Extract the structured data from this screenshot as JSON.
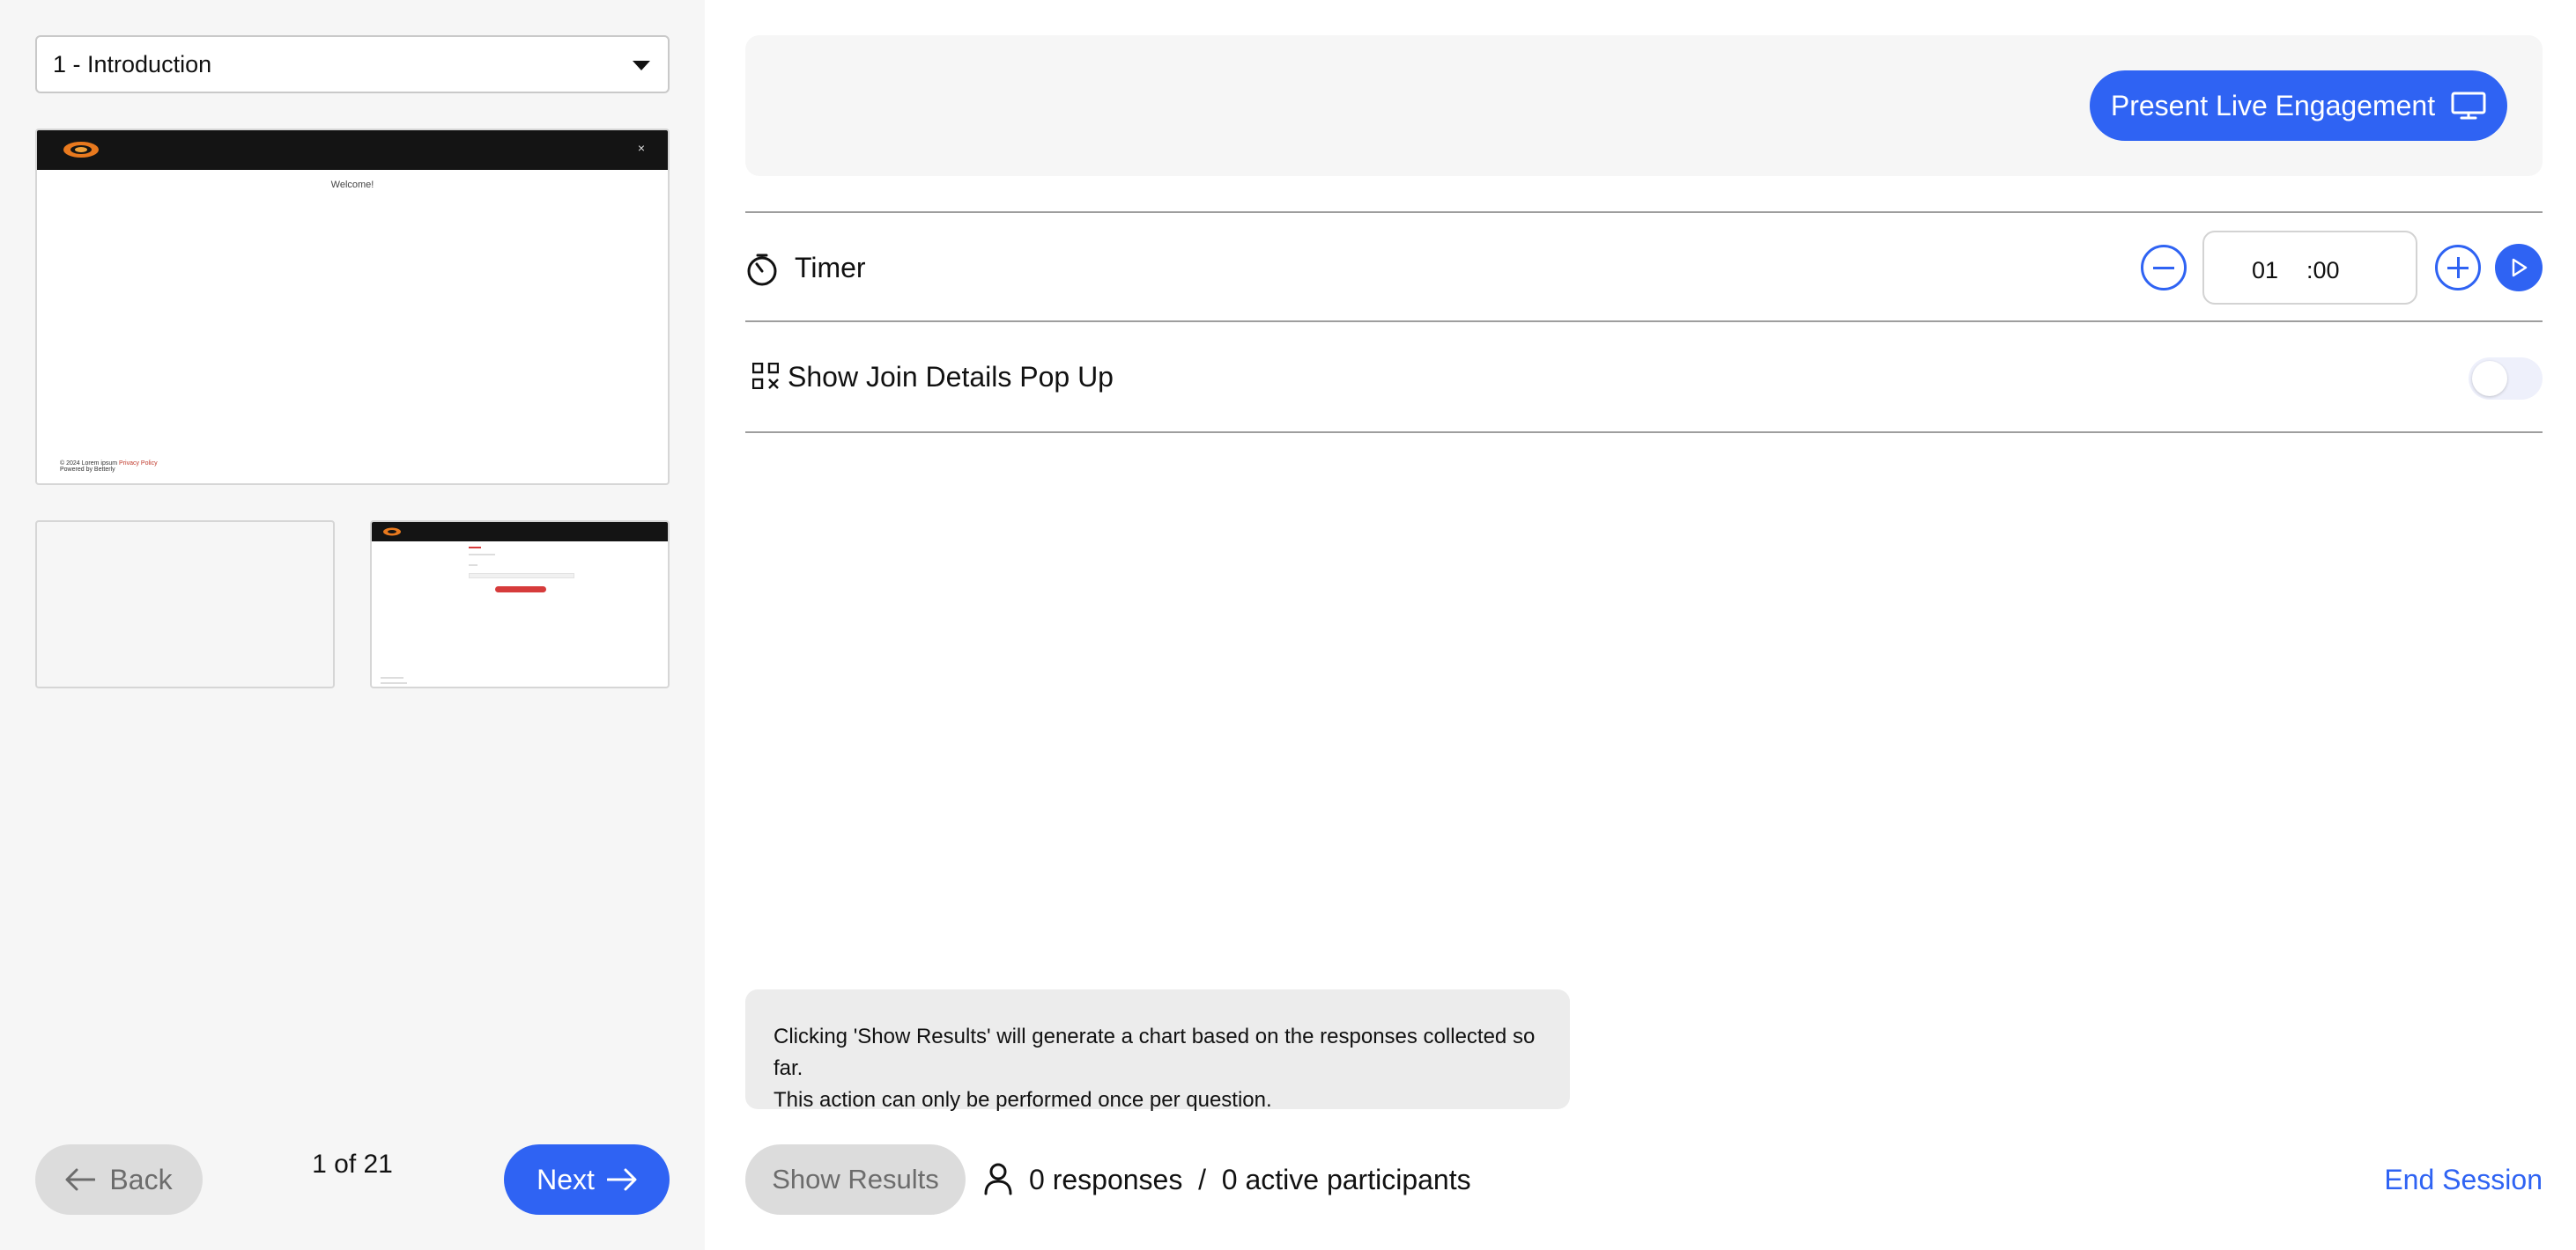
{
  "sidebar": {
    "slide_select": {
      "value": "1 - Introduction"
    },
    "thumbnail_main": {
      "welcome_text": "Welcome!",
      "footer_text": "© 2024 Lorem ipsum",
      "footer_link": "Privacy Policy",
      "footer_powered": "Powered by",
      "footer_brand": "Betterly"
    },
    "back_label": "Back",
    "page_count": "1 of 21",
    "next_label": "Next"
  },
  "main": {
    "present_label": "Present Live Engagement",
    "timer": {
      "label": "Timer",
      "minutes": "01",
      "seconds": ":00"
    },
    "join_details": {
      "label": "Show Join Details Pop Up",
      "toggle_on": false
    },
    "info_text_line1": "Clicking 'Show Results' will generate a chart based on the responses collected so far.",
    "info_text_line2": "This action can only be performed once per question.",
    "show_results_label": "Show Results",
    "responses_text": "0 responses  /  0 active participants",
    "end_session_label": "End Session"
  },
  "colors": {
    "accent": "#2f63f3",
    "sidebar_bg": "#f6f6f6",
    "disabled_btn": "#dcdcdc"
  },
  "icons": [
    "caret-down-icon",
    "arrow-left-icon",
    "arrow-right-icon",
    "monitor-icon",
    "stopwatch-icon",
    "minus-circle-icon",
    "plus-circle-icon",
    "play-icon",
    "qr-code-icon",
    "person-icon"
  ]
}
